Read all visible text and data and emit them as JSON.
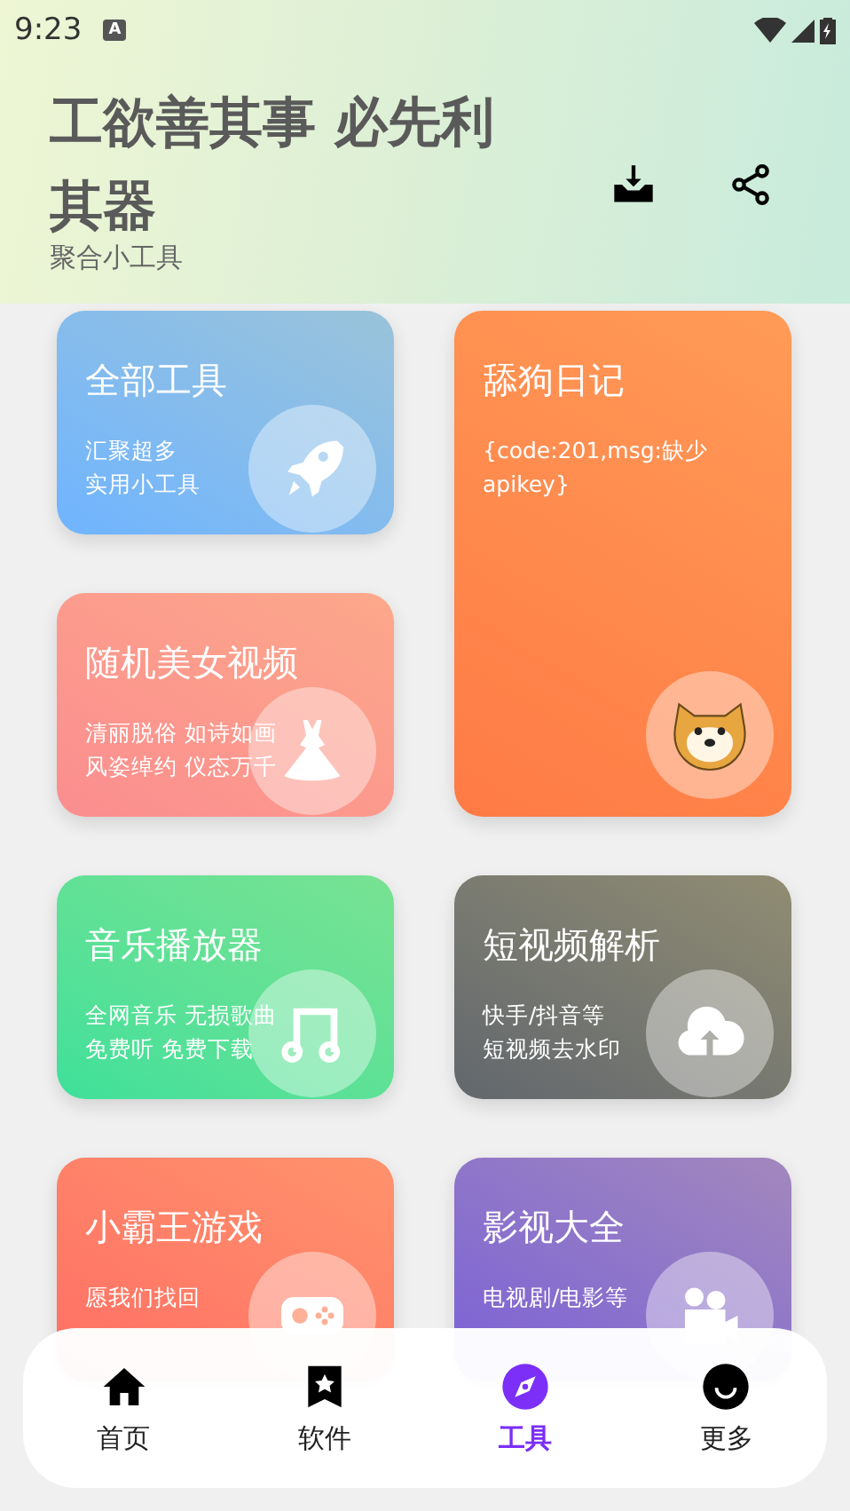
{
  "status_bar": {
    "time": "9:23",
    "badge": "A"
  },
  "header": {
    "title": "工欲善其事 必先利其器",
    "subtitle": "聚合小工具"
  },
  "cards": [
    {
      "kind": "rocket",
      "title": "全部工具",
      "lines": [
        "汇聚超多",
        "实用小工具"
      ],
      "color": "#6fb4ff"
    },
    {
      "kind": "dog",
      "title": "舔狗日记",
      "lines": [
        "{code:201,msg:缺少apikey}"
      ],
      "color": "#ff7a45"
    },
    {
      "kind": "dress",
      "title": "随机美女视频",
      "lines": [
        "清丽脱俗 如诗如画",
        "风姿绰约 仪态万千"
      ],
      "color": "#fb8d8f"
    },
    {
      "kind": "music",
      "title": "音乐播放器",
      "lines": [
        "全网音乐 无损歌曲",
        "免费听 免费下载"
      ],
      "color": "#3ee09a"
    },
    {
      "kind": "cloud",
      "title": "短视频解析",
      "lines": [
        "快手/抖音等",
        "短视频去水印"
      ],
      "color": "#62676d"
    },
    {
      "kind": "game",
      "title": "小霸王游戏",
      "lines": [
        "愿我们找回"
      ],
      "color": "#ff6e64"
    },
    {
      "kind": "camera",
      "title": "影视大全",
      "lines": [
        "电视剧/电影等"
      ],
      "color": "#7b5fd6"
    }
  ],
  "nav": [
    {
      "kind": "home",
      "label": "首页",
      "selected": false
    },
    {
      "kind": "apps",
      "label": "软件",
      "selected": false
    },
    {
      "kind": "tools",
      "label": "工具",
      "selected": true
    },
    {
      "kind": "more",
      "label": "更多",
      "selected": false
    }
  ]
}
